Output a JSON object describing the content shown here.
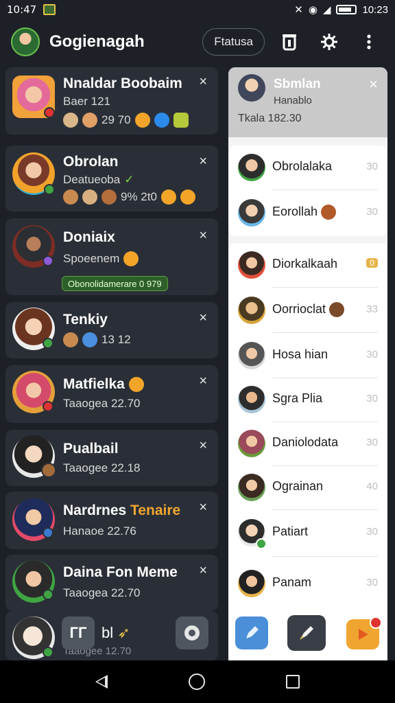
{
  "status": {
    "time": "10:47",
    "right_time": "10:23"
  },
  "app": {
    "title": "Gogienagah",
    "pill": "Ftatusa"
  },
  "cards": [
    {
      "name": "Nnaldar Boobaim",
      "sub": "Baer 121",
      "meta": "29 70",
      "close": "×"
    },
    {
      "name": "Obrolan",
      "sub": "Deatueoba",
      "meta": "9% 2t0",
      "close": "×"
    },
    {
      "name": "Doniaix",
      "sub": "Spoeenem",
      "tag": "Obonolidamerare 0 979",
      "close": "×"
    },
    {
      "name": "Tenkiy",
      "sub": "13 12",
      "close": "×"
    },
    {
      "name": "Matfielka",
      "sub": "Taaogea 22.70",
      "close": "×"
    },
    {
      "name": "Pualbail",
      "sub": "Taaogee 22.18",
      "close": "×"
    },
    {
      "name": "Nardrnes",
      "name_accent": "Tenaire",
      "sub": "Hanaoe 22.76",
      "close": "×"
    },
    {
      "name": "Daina Fon Meme",
      "sub": "Taaogea 22.70",
      "close": "×"
    },
    {
      "name": "",
      "sub": "Taaogee 12.70"
    }
  ],
  "dock": {
    "btn1": "ГГ",
    "btn2_text": "bl"
  },
  "panel": {
    "title": "Sbmlan",
    "subtitle": "Hanablo",
    "meta": "Tkala 182.30",
    "close": "×",
    "items": [
      {
        "name": "Obrolalaka",
        "count": "30"
      },
      {
        "name": "Eorollah",
        "count": "30"
      },
      {
        "name": "Diorkalkaah",
        "count": "0"
      },
      {
        "name": "Oorrioclat",
        "count": "33"
      },
      {
        "name": "Hosa hian",
        "count": "30"
      },
      {
        "name": "Sgra Plia",
        "count": "30"
      },
      {
        "name": "Daniolodata",
        "count": "30"
      },
      {
        "name": "Ograinan",
        "count": "40"
      },
      {
        "name": "Patiart",
        "count": "30"
      },
      {
        "name": "Panam",
        "count": "30"
      }
    ]
  },
  "colors": {
    "background": "#1d2127",
    "card": "#2a2f37",
    "panel": "#ffffff",
    "accent_green": "#5fa041",
    "accent_gold": "#f0a530"
  }
}
